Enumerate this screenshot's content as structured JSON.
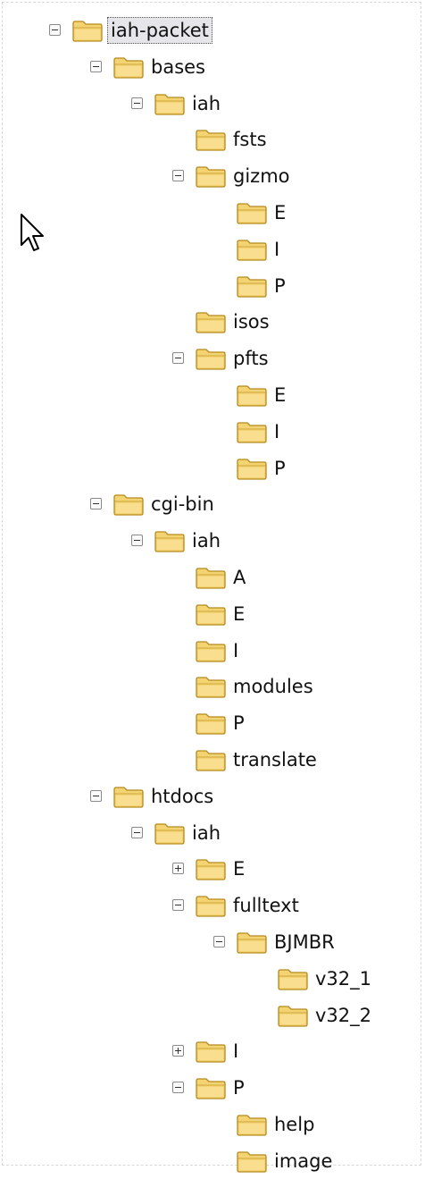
{
  "tree": [
    {
      "label": "iah-packet",
      "depth": 0,
      "toggle": "minus",
      "selected": true
    },
    {
      "label": "bases",
      "depth": 1,
      "toggle": "minus"
    },
    {
      "label": "iah",
      "depth": 2,
      "toggle": "minus"
    },
    {
      "label": "fsts",
      "depth": 3,
      "toggle": "none"
    },
    {
      "label": "gizmo",
      "depth": 3,
      "toggle": "minus"
    },
    {
      "label": "E",
      "depth": 4,
      "toggle": "none"
    },
    {
      "label": "I",
      "depth": 4,
      "toggle": "none"
    },
    {
      "label": "P",
      "depth": 4,
      "toggle": "none"
    },
    {
      "label": "isos",
      "depth": 3,
      "toggle": "none"
    },
    {
      "label": "pfts",
      "depth": 3,
      "toggle": "minus"
    },
    {
      "label": "E",
      "depth": 4,
      "toggle": "none"
    },
    {
      "label": "I",
      "depth": 4,
      "toggle": "none"
    },
    {
      "label": "P",
      "depth": 4,
      "toggle": "none"
    },
    {
      "label": "cgi-bin",
      "depth": 1,
      "toggle": "minus"
    },
    {
      "label": "iah",
      "depth": 2,
      "toggle": "minus"
    },
    {
      "label": "A",
      "depth": 3,
      "toggle": "none"
    },
    {
      "label": "E",
      "depth": 3,
      "toggle": "none"
    },
    {
      "label": "I",
      "depth": 3,
      "toggle": "none"
    },
    {
      "label": "modules",
      "depth": 3,
      "toggle": "none"
    },
    {
      "label": "P",
      "depth": 3,
      "toggle": "none"
    },
    {
      "label": "translate",
      "depth": 3,
      "toggle": "none"
    },
    {
      "label": "htdocs",
      "depth": 1,
      "toggle": "minus"
    },
    {
      "label": "iah",
      "depth": 2,
      "toggle": "minus"
    },
    {
      "label": "E",
      "depth": 3,
      "toggle": "plus"
    },
    {
      "label": "fulltext",
      "depth": 3,
      "toggle": "minus"
    },
    {
      "label": "BJMBR",
      "depth": 4,
      "toggle": "minus"
    },
    {
      "label": "v32_1",
      "depth": 5,
      "toggle": "none"
    },
    {
      "label": "v32_2",
      "depth": 5,
      "toggle": "none"
    },
    {
      "label": "I",
      "depth": 3,
      "toggle": "plus"
    },
    {
      "label": "P",
      "depth": 3,
      "toggle": "minus"
    },
    {
      "label": "help",
      "depth": 4,
      "toggle": "none"
    },
    {
      "label": "image",
      "depth": 4,
      "toggle": "none"
    }
  ],
  "icons": {
    "node": "folder-icon",
    "pointer": "mouse-cursor-icon"
  },
  "colors": {
    "folder_fill": "#f3d372",
    "folder_edge": "#b48a1e",
    "selection": "#e6e6ea"
  }
}
